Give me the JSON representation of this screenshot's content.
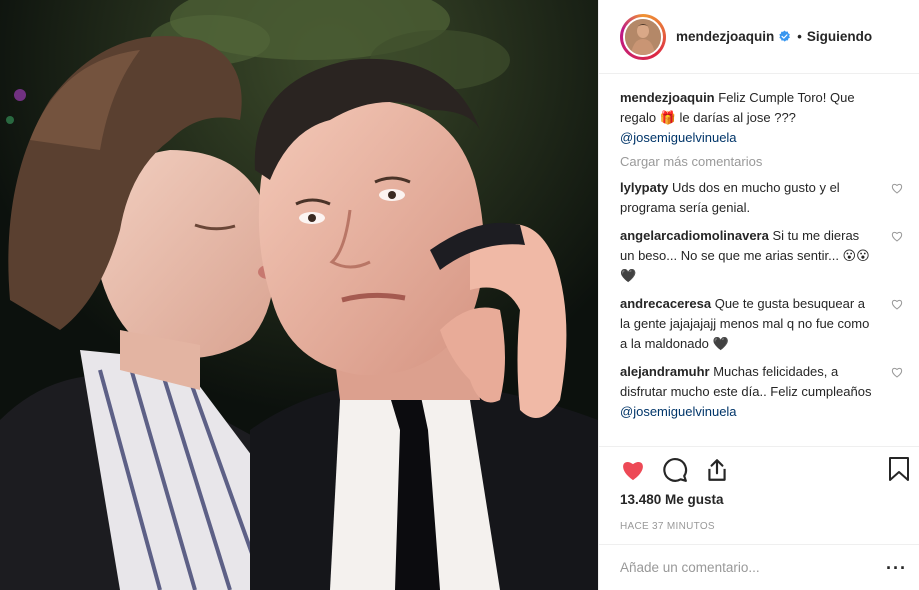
{
  "header": {
    "username": "mendezjoaquin",
    "separator": "•",
    "follow_label": "Siguiendo"
  },
  "caption": {
    "username": "mendezjoaquin",
    "text": "Feliz Cumple Toro! Que regalo 🎁 le darías al jose ??? ",
    "mention": "@josemiguelvinuela"
  },
  "load_more": "Cargar más comentarios",
  "comments": [
    {
      "username": "lylypaty",
      "text": "Uds dos en mucho gusto y el programa sería genial."
    },
    {
      "username": "angelarcadiomolinavera",
      "text": "Si tu me dieras un beso... No se que me arias sentir... 😮😮🖤"
    },
    {
      "username": "andrecaceresa",
      "text": "Que te gusta besuquear a la gente jajajajajj menos mal q no fue como a la maldonado 🖤"
    },
    {
      "username": "alejandramuhr",
      "text": "Muchas felicidades, a disfrutar mucho este día.. Feliz cumpleaños ",
      "mention": "@josemiguelvinuela"
    }
  ],
  "likes": "13.480 Me gusta",
  "time": "HACE 37 MINUTOS",
  "add_comment_placeholder": "Añade un comentario...",
  "more_label": "···",
  "colors": {
    "like_red": "#ed4956",
    "verified_blue": "#3897f0",
    "mention_blue": "#003569",
    "muted_gray": "#999999"
  },
  "icons": [
    "verified-badge-icon",
    "heart-filled-icon",
    "comment-bubble-icon",
    "share-icon",
    "bookmark-icon",
    "small-heart-icon"
  ]
}
